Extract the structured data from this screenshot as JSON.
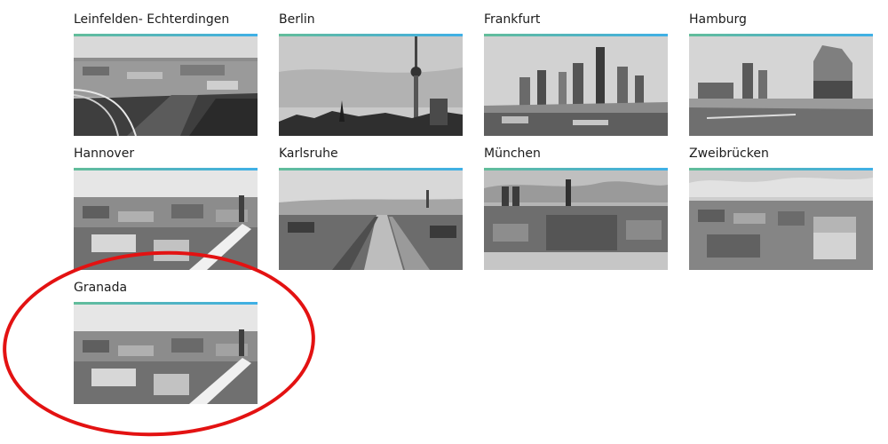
{
  "accent_colors": [
    "#62bd9a",
    "#4fb3c4",
    "#3fb0e6"
  ],
  "annotation": {
    "color": "#e31212",
    "target": "Granada"
  },
  "cities": [
    {
      "name": "Leinfelden- Echterdingen",
      "scene": "aerial-fields"
    },
    {
      "name": "Berlin",
      "scene": "tv-tower-skyline"
    },
    {
      "name": "Frankfurt",
      "scene": "highrise-skyline"
    },
    {
      "name": "Hamburg",
      "scene": "harbour-concert-hall"
    },
    {
      "name": "Hannover",
      "scene": "old-town-aerial"
    },
    {
      "name": "Karlsruhe",
      "scene": "palace-avenue-aerial"
    },
    {
      "name": "München",
      "scene": "town-hall-square"
    },
    {
      "name": "Zweibrücken",
      "scene": "city-panorama"
    },
    {
      "name": "Granada",
      "scene": "old-town-aerial"
    }
  ]
}
